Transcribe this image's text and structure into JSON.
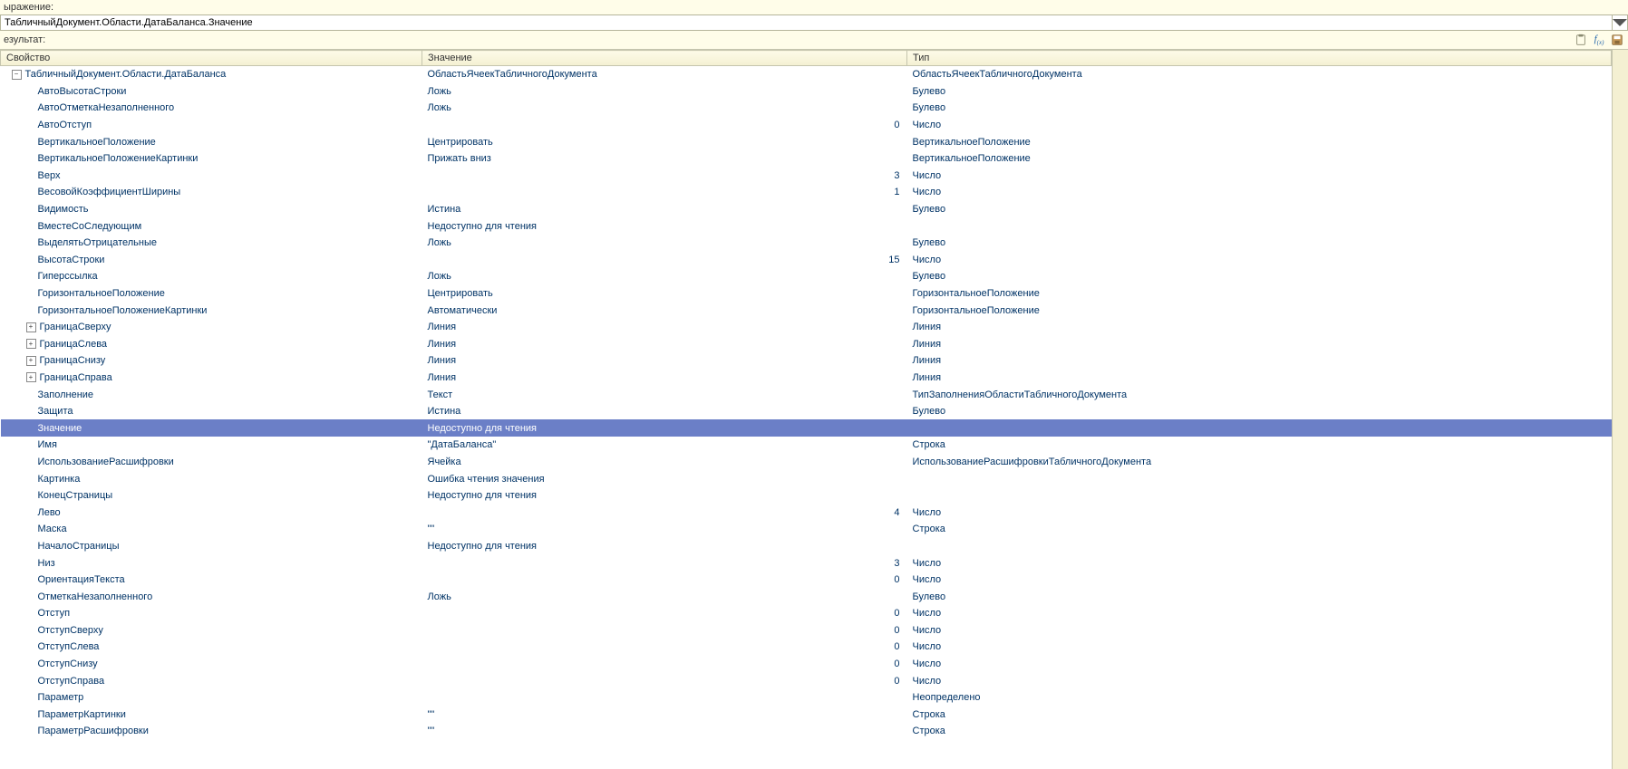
{
  "labels": {
    "expression": "ыражение:",
    "result": "езультат:"
  },
  "expression_value": "ТабличныйДокумент.Области.ДатаБаланса.Значение",
  "toolbar": {
    "icon_clipboard": "clipboard",
    "icon_fx": "fx",
    "icon_save": "save"
  },
  "columns": {
    "prop": "Свойство",
    "val": "Значение",
    "type": "Тип"
  },
  "rows": [
    {
      "indent": 0,
      "toggle": "minus",
      "prop": "ТабличныйДокумент.Области.ДатаБаланса",
      "val": "ОбластьЯчеекТабличногоДокумента",
      "type": "ОбластьЯчеекТабличногоДокумента"
    },
    {
      "indent": 1,
      "prop": "АвтоВысотаСтроки",
      "val": "Ложь",
      "type": "Булево"
    },
    {
      "indent": 1,
      "prop": "АвтоОтметкаНезаполненного",
      "val": "Ложь",
      "type": "Булево"
    },
    {
      "indent": 1,
      "prop": "АвтоОтступ",
      "val": "0",
      "num": true,
      "type": "Число"
    },
    {
      "indent": 1,
      "prop": "ВертикальноеПоложение",
      "val": "Центрировать",
      "type": "ВертикальноеПоложение"
    },
    {
      "indent": 1,
      "prop": "ВертикальноеПоложениеКартинки",
      "val": "Прижать вниз",
      "type": "ВертикальноеПоложение"
    },
    {
      "indent": 1,
      "prop": "Верх",
      "val": "3",
      "num": true,
      "type": "Число"
    },
    {
      "indent": 1,
      "prop": "ВесовойКоэффициентШирины",
      "val": "1",
      "num": true,
      "type": "Число"
    },
    {
      "indent": 1,
      "prop": "Видимость",
      "val": "Истина",
      "type": "Булево"
    },
    {
      "indent": 1,
      "prop": "ВместеСоСледующим",
      "val": "Недоступно для чтения",
      "type": ""
    },
    {
      "indent": 1,
      "prop": "ВыделятьОтрицательные",
      "val": "Ложь",
      "type": "Булево"
    },
    {
      "indent": 1,
      "prop": "ВысотаСтроки",
      "val": "15",
      "num": true,
      "type": "Число"
    },
    {
      "indent": 1,
      "prop": "Гиперссылка",
      "val": "Ложь",
      "type": "Булево"
    },
    {
      "indent": 1,
      "prop": "ГоризонтальноеПоложение",
      "val": "Центрировать",
      "type": "ГоризонтальноеПоложение"
    },
    {
      "indent": 1,
      "prop": "ГоризонтальноеПоложениеКартинки",
      "val": "Автоматически",
      "type": "ГоризонтальноеПоложение"
    },
    {
      "indent": 1,
      "toggle": "plus",
      "prop": "ГраницаСверху",
      "val": "Линия",
      "type": "Линия"
    },
    {
      "indent": 1,
      "toggle": "plus",
      "prop": "ГраницаСлева",
      "val": "Линия",
      "type": "Линия"
    },
    {
      "indent": 1,
      "toggle": "plus",
      "prop": "ГраницаСнизу",
      "val": "Линия",
      "type": "Линия"
    },
    {
      "indent": 1,
      "toggle": "plus",
      "prop": "ГраницаСправа",
      "val": "Линия",
      "type": "Линия"
    },
    {
      "indent": 1,
      "prop": "Заполнение",
      "val": "Текст",
      "type": "ТипЗаполненияОбластиТабличногоДокумента"
    },
    {
      "indent": 1,
      "prop": "Защита",
      "val": "Истина",
      "type": "Булево"
    },
    {
      "indent": 1,
      "prop": "Значение",
      "val": "Недоступно для чтения",
      "type": "",
      "selected": true
    },
    {
      "indent": 1,
      "prop": "Имя",
      "val": "\"ДатаБаланса\"",
      "type": "Строка"
    },
    {
      "indent": 1,
      "prop": "ИспользованиеРасшифровки",
      "val": "Ячейка",
      "type": "ИспользованиеРасшифровкиТабличногоДокумента"
    },
    {
      "indent": 1,
      "prop": "Картинка",
      "val": "Ошибка чтения значения",
      "type": ""
    },
    {
      "indent": 1,
      "prop": "КонецСтраницы",
      "val": "Недоступно для чтения",
      "type": ""
    },
    {
      "indent": 1,
      "prop": "Лево",
      "val": "4",
      "num": true,
      "type": "Число"
    },
    {
      "indent": 1,
      "prop": "Маска",
      "val": "\"\"",
      "type": "Строка"
    },
    {
      "indent": 1,
      "prop": "НачалоСтраницы",
      "val": "Недоступно для чтения",
      "type": ""
    },
    {
      "indent": 1,
      "prop": "Низ",
      "val": "3",
      "num": true,
      "type": "Число"
    },
    {
      "indent": 1,
      "prop": "ОриентацияТекста",
      "val": "0",
      "num": true,
      "type": "Число"
    },
    {
      "indent": 1,
      "prop": "ОтметкаНезаполненного",
      "val": "Ложь",
      "type": "Булево"
    },
    {
      "indent": 1,
      "prop": "Отступ",
      "val": "0",
      "num": true,
      "type": "Число"
    },
    {
      "indent": 1,
      "prop": "ОтступСверху",
      "val": "0",
      "num": true,
      "type": "Число"
    },
    {
      "indent": 1,
      "prop": "ОтступСлева",
      "val": "0",
      "num": true,
      "type": "Число"
    },
    {
      "indent": 1,
      "prop": "ОтступСнизу",
      "val": "0",
      "num": true,
      "type": "Число"
    },
    {
      "indent": 1,
      "prop": "ОтступСправа",
      "val": "0",
      "num": true,
      "type": "Число"
    },
    {
      "indent": 1,
      "prop": "Параметр",
      "val": "",
      "type": "Неопределено"
    },
    {
      "indent": 1,
      "prop": "ПараметрКартинки",
      "val": "\"\"",
      "type": "Строка"
    },
    {
      "indent": 1,
      "prop": "ПараметрРасшифровки",
      "val": "\"\"",
      "type": "Строка"
    }
  ]
}
